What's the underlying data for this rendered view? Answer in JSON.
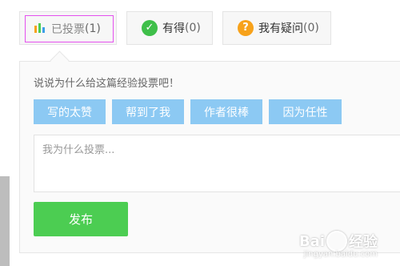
{
  "tabs": [
    {
      "label": "已投票",
      "count": "(1)",
      "icon": "bar-chart-icon",
      "active": true
    },
    {
      "label": "有得",
      "count": "(0)",
      "icon": "check-icon"
    },
    {
      "label": "我有疑问",
      "count": "(0)",
      "icon": "question-icon"
    }
  ],
  "panel": {
    "prompt": "说说为什么给这篇经验投票吧！",
    "chips": [
      "写的太赞",
      "帮到了我",
      "作者很棒",
      "因为任性"
    ],
    "textarea_placeholder": "我为什么投票...",
    "submit_label": "发布"
  },
  "watermark": {
    "brand": "Bai",
    "brand_suffix": "经验",
    "url": "jingyan.baidu.com"
  },
  "colors": {
    "chip_bg": "#8cc9f3",
    "submit_bg": "#4ccd52",
    "active_outline": "#e451ee",
    "check": "#3fbf4a",
    "question": "#f7a21b"
  }
}
